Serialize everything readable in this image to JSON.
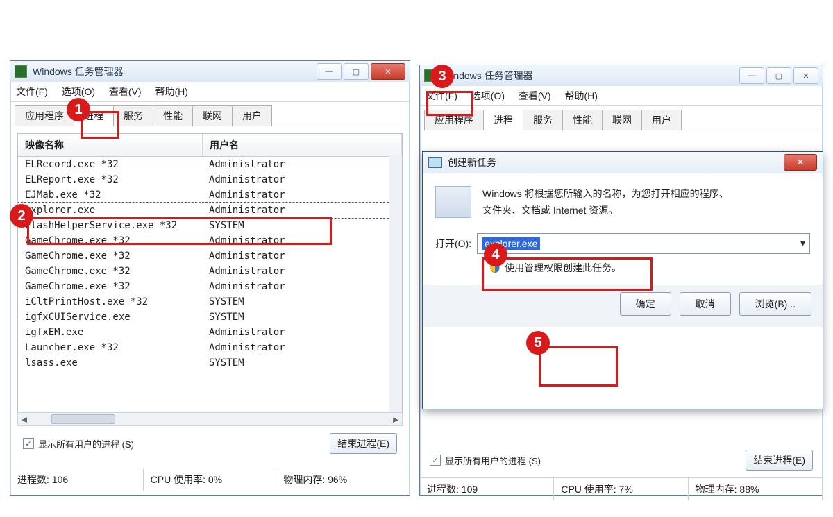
{
  "left": {
    "title": "Windows 任务管理器",
    "menus": [
      "文件(F)",
      "选项(O)",
      "查看(V)",
      "帮助(H)"
    ],
    "tabs": [
      "应用程序",
      "进程",
      "服务",
      "性能",
      "联网",
      "用户"
    ],
    "active_tab_index": 1,
    "columns": [
      "映像名称",
      "用户名"
    ],
    "rows": [
      {
        "name": "ELRecord.exe *32",
        "user": "Administrator"
      },
      {
        "name": "ELReport.exe *32",
        "user": "Administrator"
      },
      {
        "name": "EJMab.exe *32",
        "user": "Administrator"
      },
      {
        "name": "explorer.exe",
        "user": "Administrator",
        "selected": true
      },
      {
        "name": "FlashHelperService.exe *32",
        "user": "SYSTEM"
      },
      {
        "name": "GameChrome.exe *32",
        "user": "Administrator"
      },
      {
        "name": "GameChrome.exe *32",
        "user": "Administrator"
      },
      {
        "name": "GameChrome.exe *32",
        "user": "Administrator"
      },
      {
        "name": "GameChrome.exe *32",
        "user": "Administrator"
      },
      {
        "name": "iCltPrintHost.exe *32",
        "user": "SYSTEM"
      },
      {
        "name": "igfxCUIService.exe",
        "user": "SYSTEM"
      },
      {
        "name": "igfxEM.exe",
        "user": "Administrator"
      },
      {
        "name": "Launcher.exe *32",
        "user": "Administrator"
      },
      {
        "name": "lsass.exe",
        "user": "SYSTEM"
      }
    ],
    "show_all_users": "显示所有用户的进程 (S)",
    "end_process": "结束进程(E)",
    "status": {
      "procs": "进程数: 106",
      "cpu": "CPU 使用率: 0%",
      "mem": "物理内存: 96%"
    }
  },
  "right": {
    "title": "Windows 任务管理器",
    "menus": [
      "文件(F)",
      "选项(O)",
      "查看(V)",
      "帮助(H)"
    ],
    "tabs": [
      "应用程序",
      "进程",
      "服务",
      "性能",
      "联网",
      "用户"
    ],
    "active_tab_index": 1,
    "show_all_users": "显示所有用户的进程 (S)",
    "end_process": "结束进程(E)",
    "status": {
      "procs": "进程数: 109",
      "cpu": "CPU 使用率: 7%",
      "mem": "物理内存: 88%"
    }
  },
  "dialog": {
    "title": "创建新任务",
    "desc1": "Windows 将根据您所输入的名称，为您打开相应的程序、",
    "desc2": "文件夹、文档或 Internet 资源。",
    "open_label": "打开(O):",
    "open_value": "explorer.exe",
    "admin_note": "使用管理权限创建此任务。",
    "ok": "确定",
    "cancel": "取消",
    "browse": "浏览(B)..."
  },
  "badges": {
    "b1": "1",
    "b2": "2",
    "b3": "3",
    "b4": "4",
    "b5": "5"
  }
}
